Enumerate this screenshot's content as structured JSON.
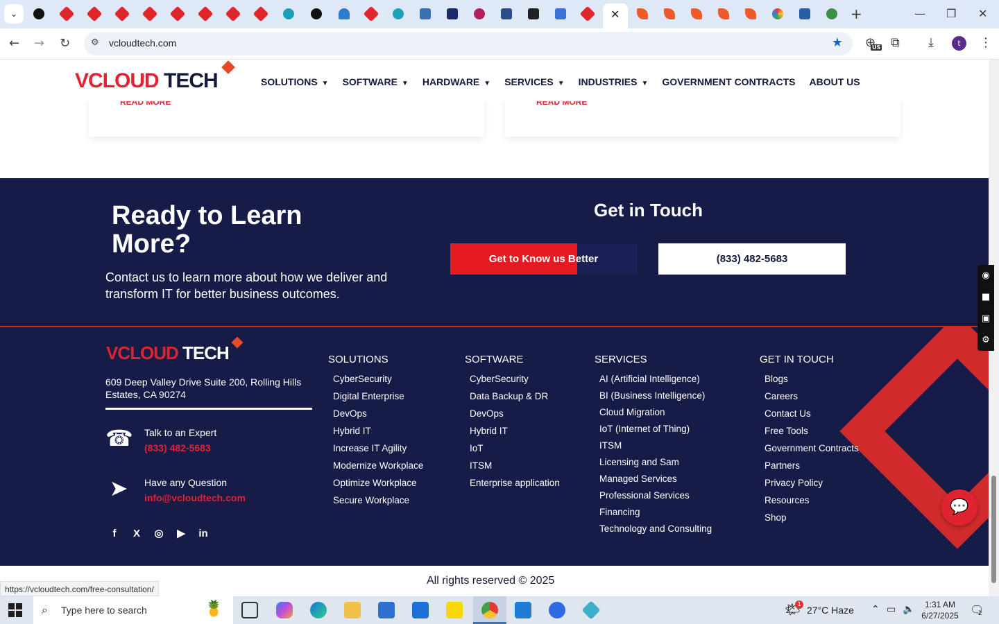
{
  "browser": {
    "url": "vcloudtech.com",
    "status_url": "https://vcloudtech.com/free-consultation/",
    "new_tab": "+",
    "profile_initial": "t",
    "ext_badge": "US"
  },
  "header": {
    "logo_v": "V",
    "logo_cloud": "CLOUD",
    "logo_tech": " TECH",
    "nav": [
      {
        "label": "SOLUTIONS",
        "caret": true
      },
      {
        "label": "SOFTWARE",
        "caret": true
      },
      {
        "label": "HARDWARE",
        "caret": true
      },
      {
        "label": "SERVICES",
        "caret": true
      },
      {
        "label": "INDUSTRIES",
        "caret": true
      },
      {
        "label": "GOVERNMENT CONTRACTS",
        "caret": false
      },
      {
        "label": "ABOUT US",
        "caret": false
      }
    ]
  },
  "cards": [
    {
      "link": "READ MORE"
    },
    {
      "link": "READ MORE"
    }
  ],
  "cta": {
    "title": "Ready to Learn More?",
    "text": "Contact us to learn more about how we deliver and transform IT for better business outcomes.",
    "subtitle": "Get in Touch",
    "button_primary": "Get to Know us Better",
    "button_phone": "(833) 482-5683"
  },
  "footer": {
    "address": "609 Deep Valley Drive Suite 200, Rolling Hills Estates, CA 90274",
    "talk_label": "Talk to an Expert",
    "talk_phone": "(833) 482-5683",
    "question_label": "Have any Question",
    "question_email": "info@vcloudtech.com",
    "socials": [
      "f",
      "X",
      "◎",
      "▶",
      "in"
    ],
    "columns": {
      "solutions": {
        "heading": "SOLUTIONS",
        "items": [
          "CyberSecurity",
          "Digital Enterprise",
          "DevOps",
          "Hybrid IT",
          "Increase IT Agility",
          "Modernize Workplace",
          "Optimize Workplace",
          "Secure Workplace"
        ]
      },
      "software": {
        "heading": "SOFTWARE",
        "items": [
          "CyberSecurity",
          "Data Backup & DR",
          "DevOps",
          "Hybrid IT",
          "IoT",
          "ITSM",
          "Enterprise application"
        ]
      },
      "services": {
        "heading": "SERVICES",
        "items": [
          "AI (Artificial Intelligence)",
          "BI (Business Intelligence)",
          "Cloud Migration",
          "IoT (Internet of Thing)",
          "ITSM",
          "Licensing and Sam",
          "Managed Services",
          "Professional Services",
          "Financing",
          "Technology and Consulting"
        ]
      },
      "contact": {
        "heading": "GET IN TOUCH",
        "items": [
          "Blogs",
          "Careers",
          "Contact Us",
          "Free Tools",
          "Government Contracts",
          "Partners",
          "Privacy Policy",
          "Resources",
          "Shop"
        ]
      }
    },
    "copyright": "All rights reserved © 2025"
  },
  "taskbar": {
    "search_placeholder": "Type here to search",
    "weather_badge": "1",
    "temperature": "27°C",
    "condition": "Haze",
    "time": "1:31 AM",
    "date": "6/27/2025",
    "notifications": "2"
  }
}
